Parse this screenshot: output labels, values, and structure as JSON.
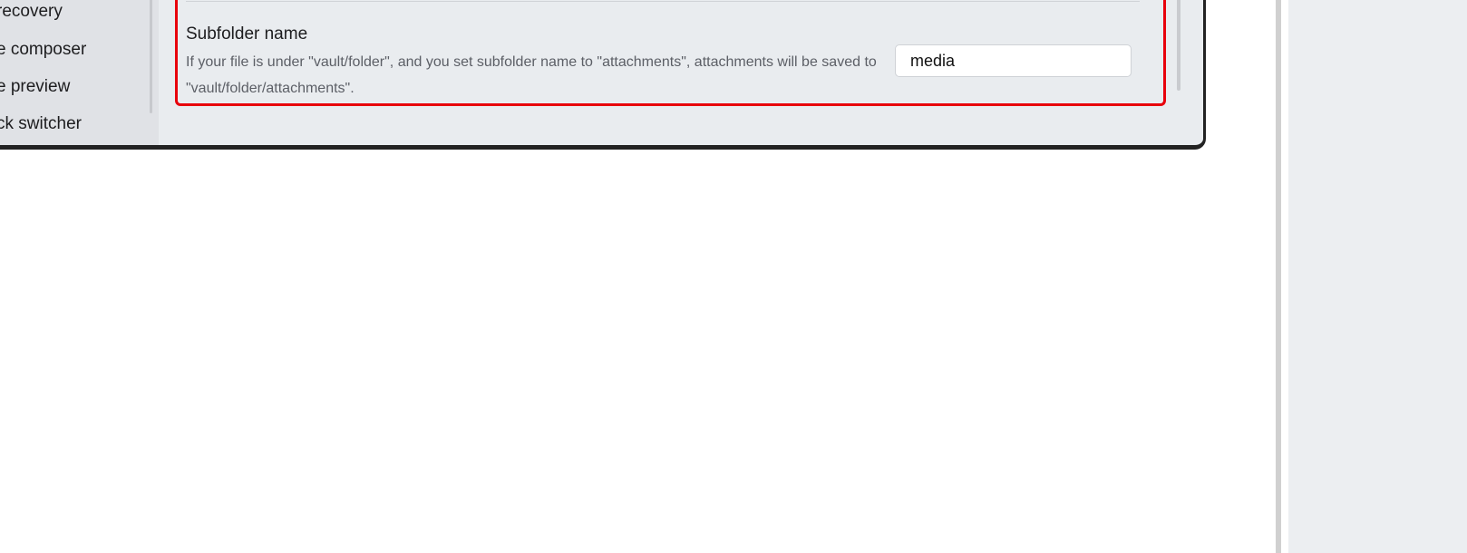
{
  "sidebar": {
    "items": [
      {
        "label": "recovery"
      },
      {
        "label": "e composer"
      },
      {
        "label": "e preview"
      },
      {
        "label": "ck switcher"
      }
    ]
  },
  "setting": {
    "name": "Subfolder name",
    "description": "If your file is under \"vault/folder\", and you set subfolder name to \"attachments\", attachments will be saved to \"vault/folder/attachments\".",
    "input_value": "media"
  },
  "colors": {
    "highlight": "#e8000b",
    "window_bg": "#e9ecef",
    "sidebar_bg": "#e0e2e6",
    "right_panel_bg": "#eceef1"
  }
}
